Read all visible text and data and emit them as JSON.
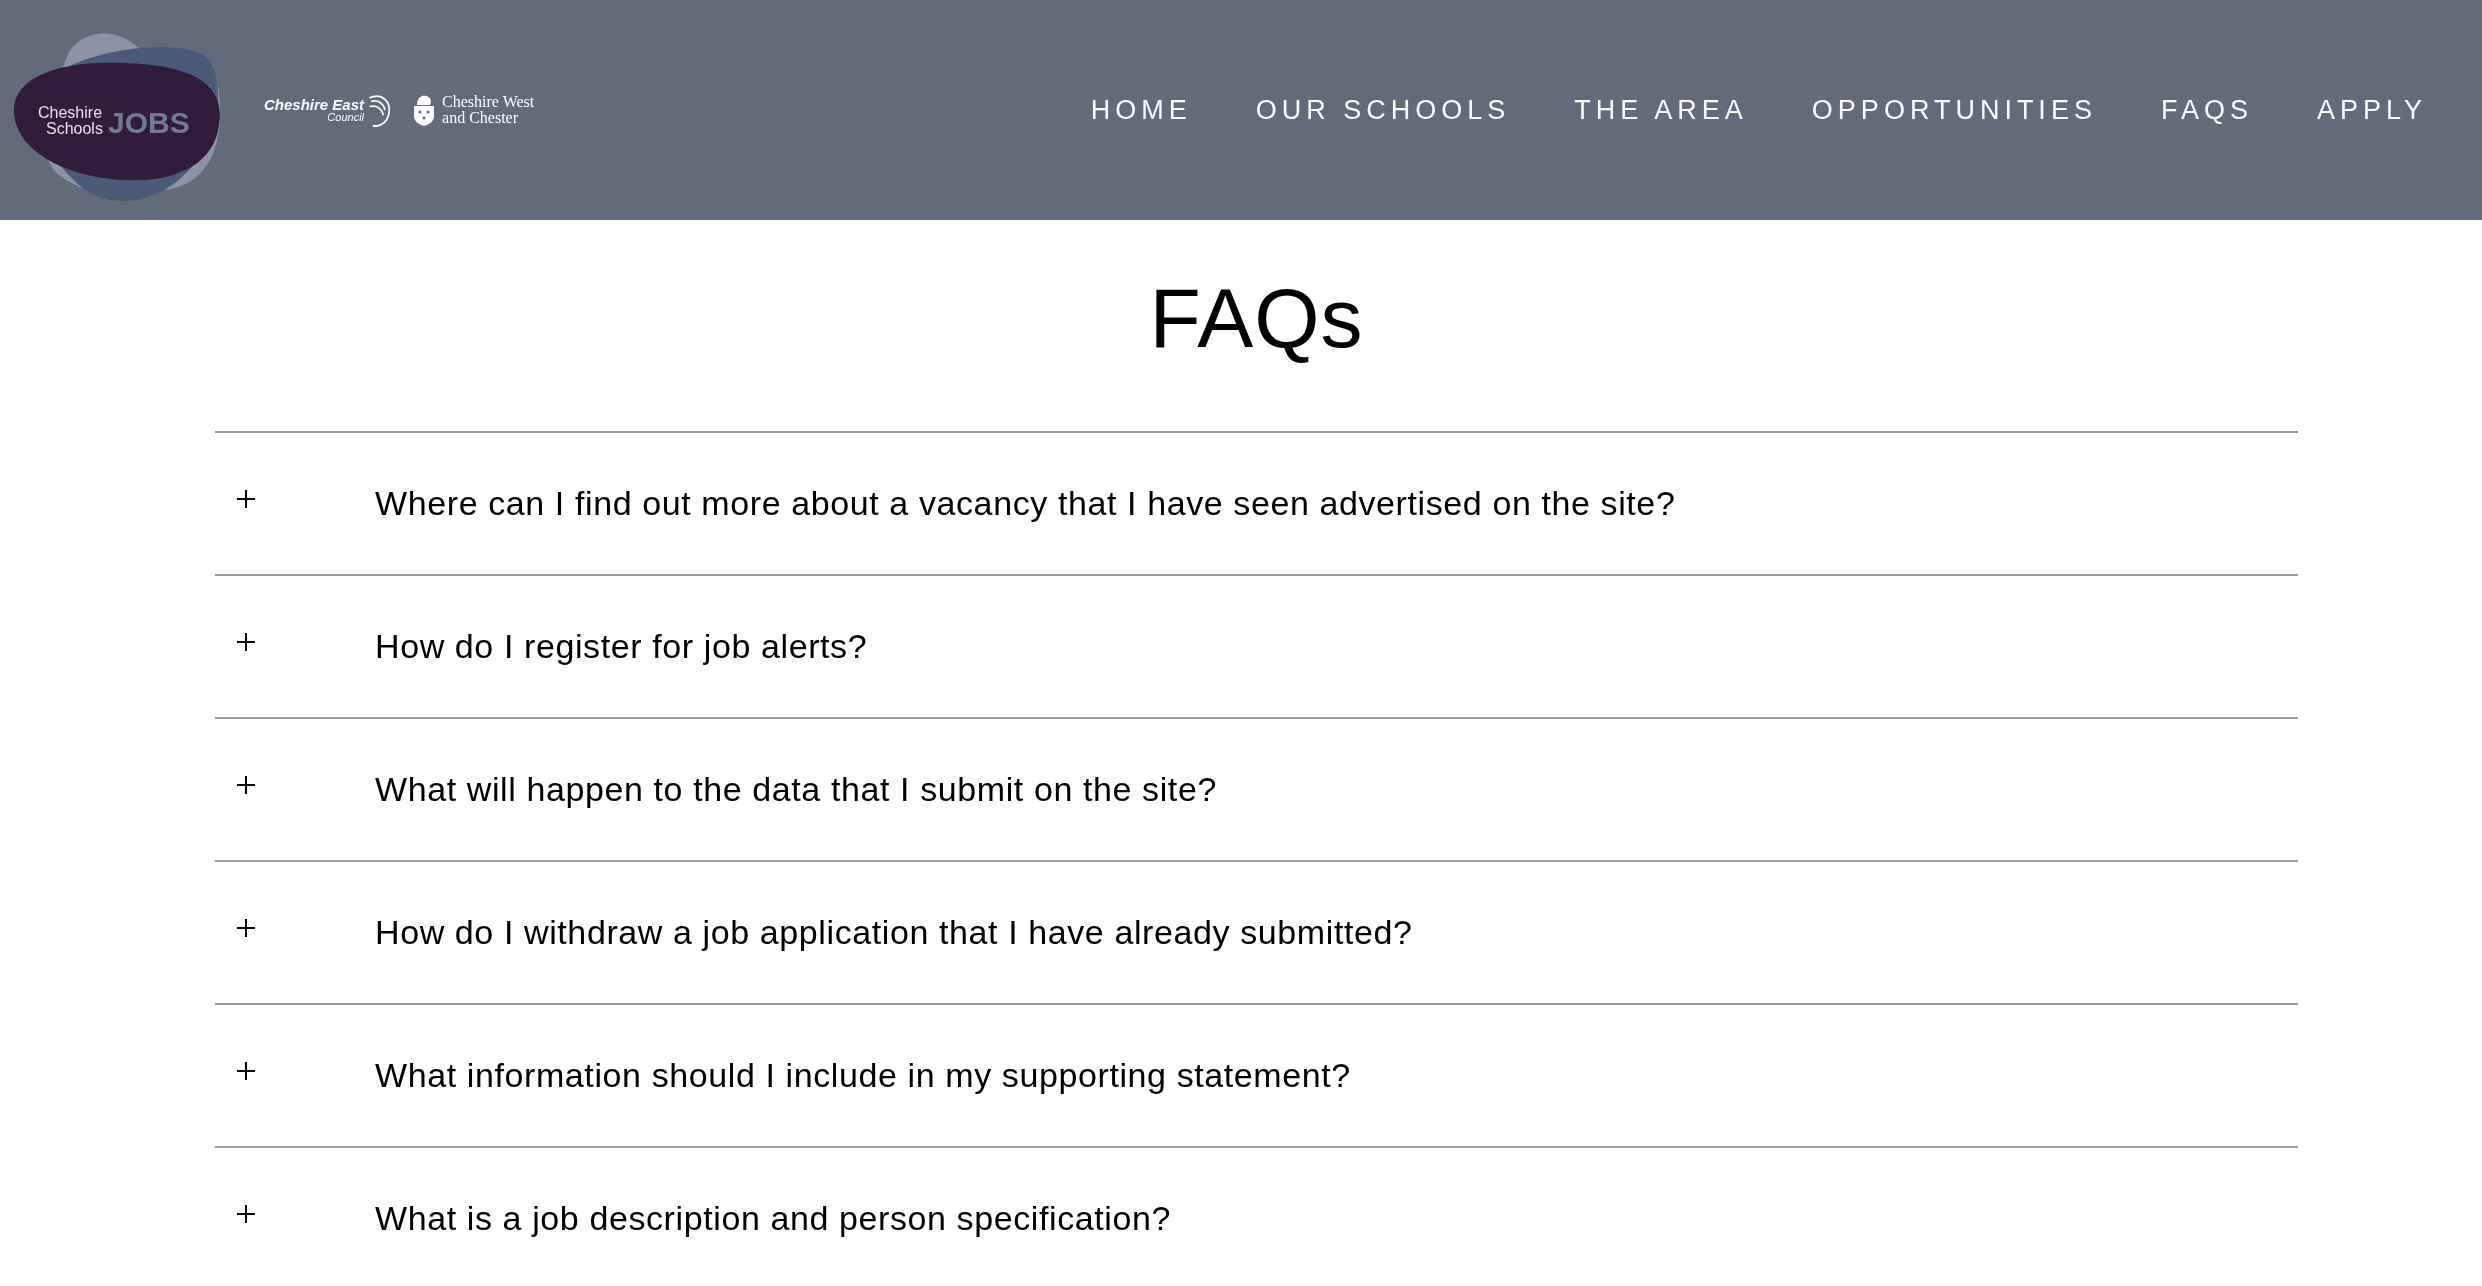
{
  "logo": {
    "line_1": "Cheshire",
    "line_2": "Schools",
    "word": "JOBS"
  },
  "partners": [
    {
      "kind": "east",
      "name": "Cheshire East",
      "sub": "Council"
    },
    {
      "kind": "west",
      "name": "Cheshire West",
      "sub": "and Chester"
    }
  ],
  "nav": [
    {
      "label": "HOME",
      "selected": false
    },
    {
      "label": "OUR SCHOOLS",
      "selected": false
    },
    {
      "label": "THE AREA",
      "selected": false
    },
    {
      "label": "OPPORTUNITIES",
      "selected": false
    },
    {
      "label": "FAQS",
      "selected": false
    },
    {
      "label": "APPLY",
      "selected": false
    }
  ],
  "title": "FAQs",
  "faqs": [
    {
      "question": "Where can I find out more about a vacancy that I have seen advertised on the site?",
      "expanded": false
    },
    {
      "question": "How do I register for job alerts?",
      "expanded": false
    },
    {
      "question": "What will happen to the data that I submit on the site?",
      "expanded": false
    },
    {
      "question": "How do I withdraw a job application that I have already submitted?",
      "expanded": false
    },
    {
      "question": "What information should I include in my supporting statement?",
      "expanded": false
    },
    {
      "question": "What is a job description and person specification?",
      "expanded": false
    }
  ]
}
